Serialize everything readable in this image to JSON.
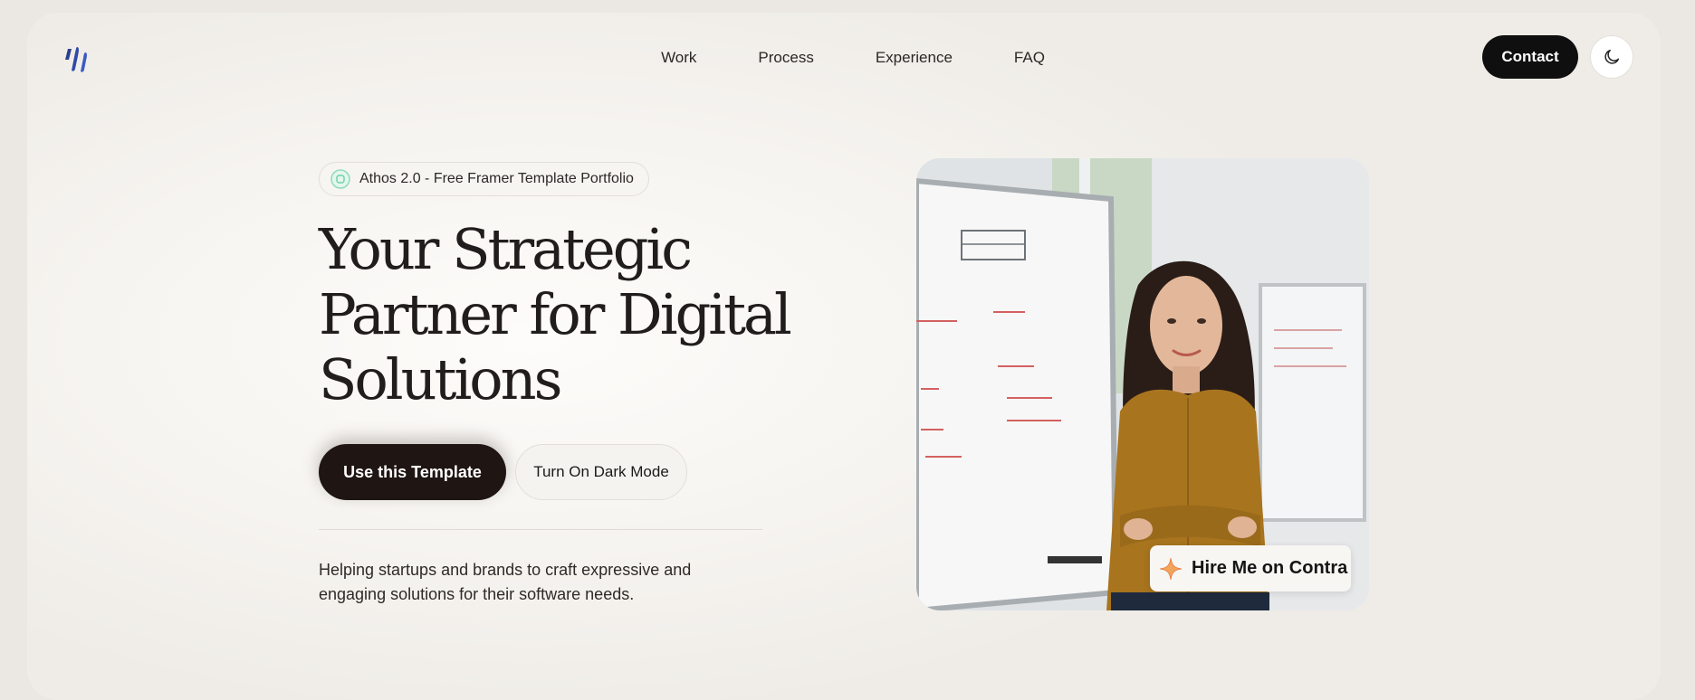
{
  "header": {
    "logo_icon": "brand-logo-icon",
    "nav": [
      {
        "label": "Work"
      },
      {
        "label": "Process"
      },
      {
        "label": "Experience"
      },
      {
        "label": "FAQ"
      }
    ],
    "contact_label": "Contact",
    "theme_toggle_icon": "moon-icon"
  },
  "hero": {
    "badge_icon": "circle-dot-icon",
    "badge_text": "Athos 2.0 - Free Framer Template Portfolio",
    "title_lines": [
      "Your Strategic",
      "Partner for Digital",
      "Solutions"
    ],
    "primary_button": "Use this Template",
    "secondary_button": "Turn On Dark Mode",
    "tagline": "Helping startups and brands to craft expressive and engaging solutions for their software needs.",
    "image_alt": "woman-at-whiteboard-photo",
    "hire_badge": {
      "icon": "contra-star-icon",
      "label": "Hire Me on Contra"
    }
  },
  "colors": {
    "page_bg": "#ebe8e3",
    "primary_button": "#1f1513",
    "contact_button": "#0f0f0f",
    "badge_accent": "#6fd3a6",
    "logo": "#2b3f8f",
    "contra_accent": "#f2a45c"
  }
}
